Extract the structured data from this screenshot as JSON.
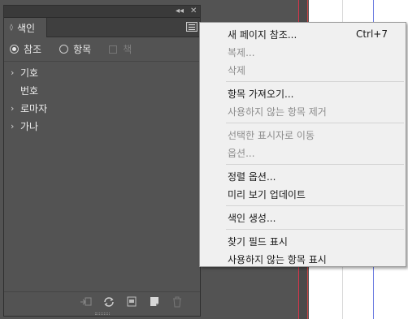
{
  "panel": {
    "collapse_icon": "double-chevron-left-icon",
    "close_icon": "close-icon",
    "tab_label": "색인",
    "menu_icon": "hamburger-icon",
    "radios": [
      {
        "label": "참조",
        "selected": true
      },
      {
        "label": "항목",
        "selected": false
      }
    ],
    "checkbox_label": "책",
    "items": [
      {
        "label": "기호",
        "has_arrow": true
      },
      {
        "label": "번호",
        "has_arrow": false
      },
      {
        "label": "로마자",
        "has_arrow": true
      },
      {
        "label": "가나",
        "has_arrow": true
      }
    ],
    "bottom_icons": [
      "go-to-topic-icon",
      "refresh-icon",
      "new-page-icon",
      "new-entry-icon",
      "trash-icon"
    ]
  },
  "menu": {
    "items": [
      {
        "label": "새 페이지 참조...",
        "shortcut": "Ctrl+7",
        "disabled": false
      },
      {
        "label": "복제...",
        "shortcut": "",
        "disabled": true
      },
      {
        "label": "삭제",
        "shortcut": "",
        "disabled": true
      },
      {
        "separator": true
      },
      {
        "label": "항목 가져오기...",
        "shortcut": "",
        "disabled": false
      },
      {
        "label": "사용하지 않는 항목 제거",
        "shortcut": "",
        "disabled": true
      },
      {
        "separator": true
      },
      {
        "label": "선택한 표시자로 이동",
        "shortcut": "",
        "disabled": true
      },
      {
        "label": "옵션...",
        "shortcut": "",
        "disabled": true
      },
      {
        "separator": true
      },
      {
        "label": "정렬 옵션...",
        "shortcut": "",
        "disabled": false
      },
      {
        "label": "미리 보기 업데이트",
        "shortcut": "",
        "disabled": false
      },
      {
        "separator": true
      },
      {
        "label": "색인 생성...",
        "shortcut": "",
        "disabled": false
      },
      {
        "separator": true
      },
      {
        "label": "찾기 필드 표시",
        "shortcut": "",
        "disabled": false
      },
      {
        "label": "사용하지 않는 항목 표시",
        "shortcut": "",
        "disabled": false
      }
    ]
  },
  "colors": {
    "panel_bg": "#535353",
    "menu_bg": "#f0f0f0",
    "guide_red": "#d8344a",
    "guide_blue": "#6b7be0"
  }
}
